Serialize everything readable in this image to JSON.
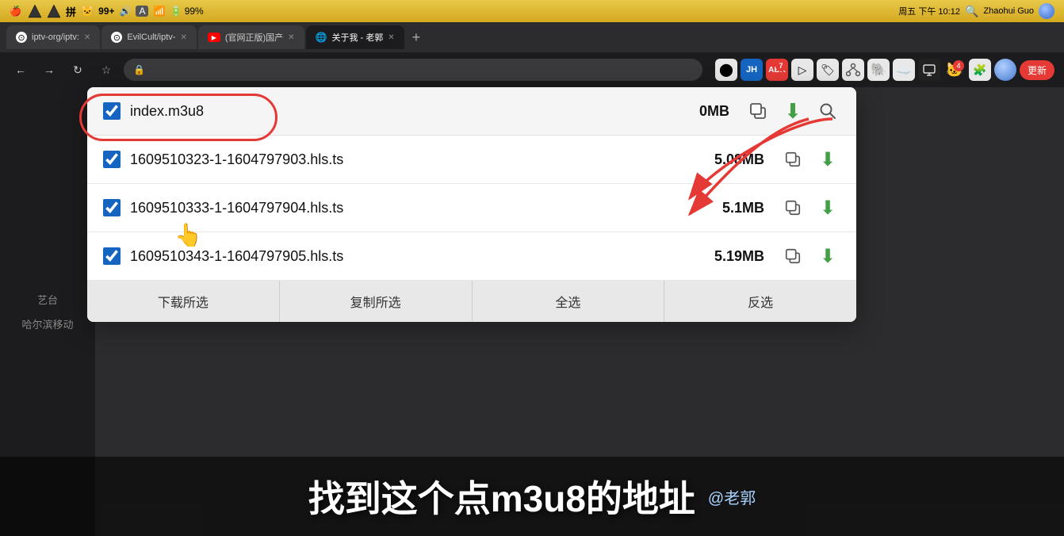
{
  "menubar": {
    "left_icons": [
      "🍎",
      "V",
      "V",
      "拼",
      "🐱‍👤",
      "99+",
      "🔊",
      "A",
      "📶",
      "🔋"
    ],
    "right_text": "周五 下午 10:12",
    "right_user": "Zhaohui Guo",
    "battery": "99%"
  },
  "tabs": [
    {
      "id": "tab1",
      "icon": "gh",
      "label": "iptv-org/iptv:",
      "active": false
    },
    {
      "id": "tab2",
      "icon": "gh",
      "label": "EvilCult/iptv-",
      "active": false
    },
    {
      "id": "tab3",
      "icon": "yt",
      "label": "(官网正版)国产",
      "active": false
    },
    {
      "id": "tab4",
      "icon": "globe",
      "label": "关于我 - 老郭",
      "active": true
    }
  ],
  "toolbar": {
    "address": "",
    "update_label": "更新"
  },
  "sidebar": {
    "items": [
      {
        "label": "艺台"
      },
      {
        "label": "哈尔滨移动"
      }
    ]
  },
  "dropdown": {
    "header": {
      "filename": "index.m3u8",
      "size": "0MB",
      "checked": true
    },
    "items": [
      {
        "filename": "1609510323-1-1604797903.hls.ts",
        "size": "5.08MB",
        "checked": true
      },
      {
        "filename": "1609510333-1-1604797904.hls.ts",
        "size": "5.1MB",
        "checked": true
      },
      {
        "filename": "1609510343-1-1604797905.hls.ts",
        "size": "5.19MB",
        "checked": true
      }
    ],
    "actions": [
      {
        "label": "下载所选",
        "id": "download"
      },
      {
        "label": "复制所选",
        "id": "copy"
      },
      {
        "label": "全选",
        "id": "select-all"
      },
      {
        "label": "反选",
        "id": "invert"
      }
    ]
  },
  "subtitle": {
    "main": "找到这个点m3u8的地址",
    "handle": "@老郭"
  },
  "icons": {
    "copy": "🗒",
    "search": "🔍",
    "download_green": "⬇",
    "checkbox_checked": "✓"
  }
}
